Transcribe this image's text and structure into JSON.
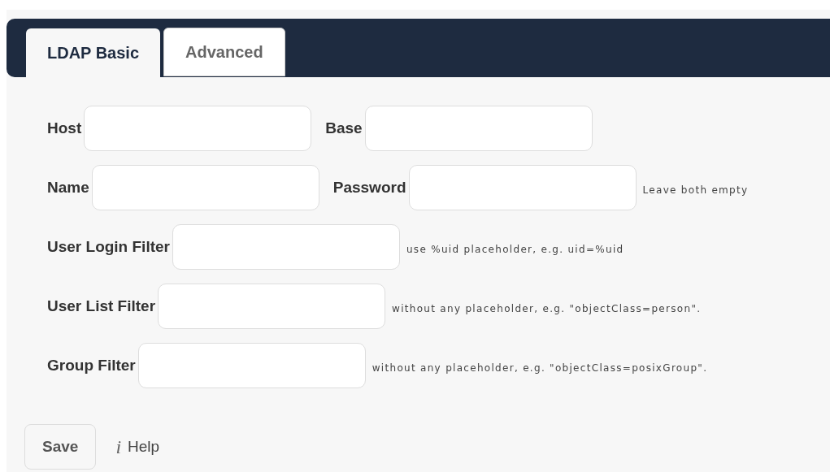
{
  "tabs": [
    {
      "label": "LDAP Basic",
      "selected": true
    },
    {
      "label": "Advanced",
      "selected": false
    }
  ],
  "rows": [
    {
      "fields": [
        {
          "label": "Host"
        },
        {
          "label": "Base"
        }
      ]
    },
    {
      "fields": [
        {
          "label": "Name"
        },
        {
          "label": "Password"
        }
      ],
      "hint": "Leave both empty"
    },
    {
      "fields": [
        {
          "label": "User Login Filter"
        }
      ],
      "hint": "use %uid placeholder, e.g. uid=%uid"
    },
    {
      "fields": [
        {
          "label": "User List Filter"
        }
      ],
      "hint": "without any placeholder, e.g. \"objectClass=person\"."
    },
    {
      "fields": [
        {
          "label": "Group Filter"
        }
      ],
      "hint": "without any placeholder, e.g. \"objectClass=posixGroup\"."
    }
  ],
  "save_button": "Save",
  "help_icon": "i",
  "help_link": "Help"
}
